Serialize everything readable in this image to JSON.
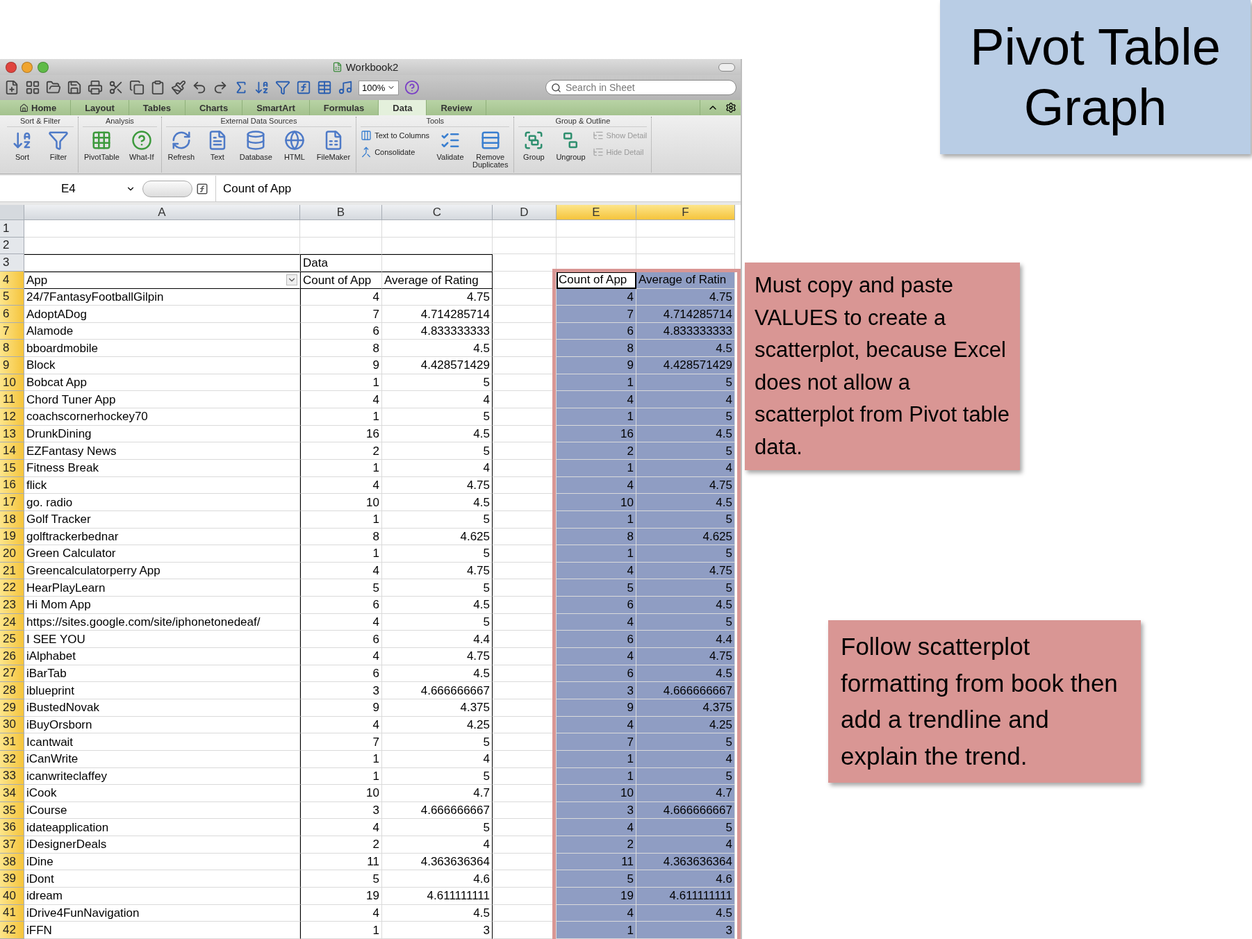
{
  "slide_title": "Pivot Table Graph",
  "callouts": [
    "Must copy and paste VALUES to create a scatterplot, because Excel does not allow a scatterplot from Pivot table data.",
    "Follow scatterplot formatting from book then add a trendline and explain the trend."
  ],
  "window": {
    "title": "Workbook2",
    "zoom": "100%",
    "search": {
      "placeholder": "Search in Sheet"
    }
  },
  "tabs": [
    {
      "label": "Home",
      "selected": false
    },
    {
      "label": "Layout",
      "selected": false
    },
    {
      "label": "Tables",
      "selected": false
    },
    {
      "label": "Charts",
      "selected": false
    },
    {
      "label": "SmartArt",
      "selected": false
    },
    {
      "label": "Formulas",
      "selected": false
    },
    {
      "label": "Data",
      "selected": true
    },
    {
      "label": "Review",
      "selected": false
    }
  ],
  "ribbon": [
    {
      "title": "Sort & Filter",
      "buttons": [
        {
          "label": "Sort",
          "kind": "large",
          "disabled": false
        },
        {
          "label": "Filter",
          "kind": "large",
          "disabled": false
        }
      ]
    },
    {
      "title": "Analysis",
      "buttons": [
        {
          "label": "PivotTable",
          "kind": "large",
          "disabled": false
        },
        {
          "label": "What-If",
          "kind": "large",
          "disabled": false
        }
      ]
    },
    {
      "title": "External Data Sources",
      "buttons": [
        {
          "label": "Refresh",
          "kind": "large",
          "disabled": false
        },
        {
          "label": "Text",
          "kind": "large",
          "disabled": false
        },
        {
          "label": "Database",
          "kind": "large",
          "disabled": false
        },
        {
          "label": "HTML",
          "kind": "large",
          "disabled": false
        },
        {
          "label": "FileMaker",
          "kind": "large",
          "disabled": false
        }
      ]
    },
    {
      "title": "Tools",
      "buttons": [
        {
          "label": "Text to Columns",
          "kind": "small",
          "disabled": false
        },
        {
          "label": "Consolidate",
          "kind": "small",
          "disabled": false
        },
        {
          "label": "Validate",
          "kind": "large",
          "disabled": false
        },
        {
          "label": "Remove Duplicates",
          "kind": "large",
          "disabled": false
        }
      ]
    },
    {
      "title": "Group & Outline",
      "buttons": [
        {
          "label": "Group",
          "kind": "large",
          "disabled": false
        },
        {
          "label": "Ungroup",
          "kind": "large",
          "disabled": false
        },
        {
          "label": "Show Detail",
          "kind": "small",
          "disabled": true
        },
        {
          "label": "Hide Detail",
          "kind": "small",
          "disabled": true
        }
      ]
    }
  ],
  "formula_bar": {
    "name_box": "E4",
    "formula": "Count of App"
  },
  "columns": [
    {
      "label": "A",
      "selected": false
    },
    {
      "label": "B",
      "selected": false
    },
    {
      "label": "C",
      "selected": false
    },
    {
      "label": "D",
      "selected": false
    },
    {
      "label": "E",
      "selected": true
    },
    {
      "label": "F",
      "selected": true
    }
  ],
  "rows": [
    {
      "number": "1",
      "kind": "blank",
      "selected": false,
      "cells": {}
    },
    {
      "number": "2",
      "kind": "blank",
      "selected": false,
      "cells": {}
    },
    {
      "number": "3",
      "kind": "caption",
      "selected": false,
      "cells": {
        "b": "Data"
      }
    },
    {
      "number": "4",
      "kind": "header",
      "selected": true,
      "cells": {
        "a": "App",
        "b": "Count of App",
        "c": "Average of Rating",
        "e": "Count of App",
        "f": "Average of Ratin"
      }
    },
    {
      "number": "5",
      "kind": "record",
      "selected": true,
      "cells": {
        "a": "24/7FantasyFootballGilpin",
        "b": "4",
        "c": "4.75",
        "e": "4",
        "f": "4.75"
      }
    },
    {
      "number": "6",
      "kind": "record",
      "selected": true,
      "cells": {
        "a": "AdoptADog",
        "b": "7",
        "c": "4.714285714",
        "e": "7",
        "f": "4.714285714"
      }
    },
    {
      "number": "7",
      "kind": "record",
      "selected": true,
      "cells": {
        "a": "Alamode",
        "b": "6",
        "c": "4.833333333",
        "e": "6",
        "f": "4.833333333"
      }
    },
    {
      "number": "8",
      "kind": "record",
      "selected": true,
      "cells": {
        "a": "bboardmobile",
        "b": "8",
        "c": "4.5",
        "e": "8",
        "f": "4.5"
      }
    },
    {
      "number": "9",
      "kind": "record",
      "selected": true,
      "cells": {
        "a": "Block",
        "b": "9",
        "c": "4.428571429",
        "e": "9",
        "f": "4.428571429"
      }
    },
    {
      "number": "10",
      "kind": "record",
      "selected": true,
      "cells": {
        "a": "Bobcat App",
        "b": "1",
        "c": "5",
        "e": "1",
        "f": "5"
      }
    },
    {
      "number": "11",
      "kind": "record",
      "selected": true,
      "cells": {
        "a": "Chord Tuner App",
        "b": "4",
        "c": "4",
        "e": "4",
        "f": "4"
      }
    },
    {
      "number": "12",
      "kind": "record",
      "selected": true,
      "cells": {
        "a": "coachscornerhockey70",
        "b": "1",
        "c": "5",
        "e": "1",
        "f": "5"
      }
    },
    {
      "number": "13",
      "kind": "record",
      "selected": true,
      "cells": {
        "a": "DrunkDining",
        "b": "16",
        "c": "4.5",
        "e": "16",
        "f": "4.5"
      }
    },
    {
      "number": "14",
      "kind": "record",
      "selected": true,
      "cells": {
        "a": "EZFantasy News",
        "b": "2",
        "c": "5",
        "e": "2",
        "f": "5"
      }
    },
    {
      "number": "15",
      "kind": "record",
      "selected": true,
      "cells": {
        "a": "Fitness Break",
        "b": "1",
        "c": "4",
        "e": "1",
        "f": "4"
      }
    },
    {
      "number": "16",
      "kind": "record",
      "selected": true,
      "cells": {
        "a": "flick",
        "b": "4",
        "c": "4.75",
        "e": "4",
        "f": "4.75"
      }
    },
    {
      "number": "17",
      "kind": "record",
      "selected": true,
      "cells": {
        "a": "go. radio",
        "b": "10",
        "c": "4.5",
        "e": "10",
        "f": "4.5"
      }
    },
    {
      "number": "18",
      "kind": "record",
      "selected": true,
      "cells": {
        "a": "Golf Tracker",
        "b": "1",
        "c": "5",
        "e": "1",
        "f": "5"
      }
    },
    {
      "number": "19",
      "kind": "record",
      "selected": true,
      "cells": {
        "a": "golftrackerbednar",
        "b": "8",
        "c": "4.625",
        "e": "8",
        "f": "4.625"
      }
    },
    {
      "number": "20",
      "kind": "record",
      "selected": true,
      "cells": {
        "a": "Green Calculator",
        "b": "1",
        "c": "5",
        "e": "1",
        "f": "5"
      }
    },
    {
      "number": "21",
      "kind": "record",
      "selected": true,
      "cells": {
        "a": "Greencalculatorperry App",
        "b": "4",
        "c": "4.75",
        "e": "4",
        "f": "4.75"
      }
    },
    {
      "number": "22",
      "kind": "record",
      "selected": true,
      "cells": {
        "a": "HearPlayLearn",
        "b": "5",
        "c": "5",
        "e": "5",
        "f": "5"
      }
    },
    {
      "number": "23",
      "kind": "record",
      "selected": true,
      "cells": {
        "a": "Hi Mom App",
        "b": "6",
        "c": "4.5",
        "e": "6",
        "f": "4.5"
      }
    },
    {
      "number": "24",
      "kind": "record",
      "selected": true,
      "cells": {
        "a": "https://sites.google.com/site/iphonetonedeaf/",
        "b": "4",
        "c": "5",
        "e": "4",
        "f": "5"
      }
    },
    {
      "number": "25",
      "kind": "record",
      "selected": true,
      "cells": {
        "a": "I SEE YOU",
        "b": "6",
        "c": "4.4",
        "e": "6",
        "f": "4.4"
      }
    },
    {
      "number": "26",
      "kind": "record",
      "selected": true,
      "cells": {
        "a": "iAlphabet",
        "b": "4",
        "c": "4.75",
        "e": "4",
        "f": "4.75"
      }
    },
    {
      "number": "27",
      "kind": "record",
      "selected": true,
      "cells": {
        "a": "iBarTab",
        "b": "6",
        "c": "4.5",
        "e": "6",
        "f": "4.5"
      }
    },
    {
      "number": "28",
      "kind": "record",
      "selected": true,
      "cells": {
        "a": "iblueprint",
        "b": "3",
        "c": "4.666666667",
        "e": "3",
        "f": "4.666666667"
      }
    },
    {
      "number": "29",
      "kind": "record",
      "selected": true,
      "cells": {
        "a": "iBustedNovak",
        "b": "9",
        "c": "4.375",
        "e": "9",
        "f": "4.375"
      }
    },
    {
      "number": "30",
      "kind": "record",
      "selected": true,
      "cells": {
        "a": "iBuyOrsborn",
        "b": "4",
        "c": "4.25",
        "e": "4",
        "f": "4.25"
      }
    },
    {
      "number": "31",
      "kind": "record",
      "selected": true,
      "cells": {
        "a": "Icantwait",
        "b": "7",
        "c": "5",
        "e": "7",
        "f": "5"
      }
    },
    {
      "number": "32",
      "kind": "record",
      "selected": true,
      "cells": {
        "a": "iCanWrite",
        "b": "1",
        "c": "4",
        "e": "1",
        "f": "4"
      }
    },
    {
      "number": "33",
      "kind": "record",
      "selected": true,
      "cells": {
        "a": "icanwriteclaffey",
        "b": "1",
        "c": "5",
        "e": "1",
        "f": "5"
      }
    },
    {
      "number": "34",
      "kind": "record",
      "selected": true,
      "cells": {
        "a": "iCook",
        "b": "10",
        "c": "4.7",
        "e": "10",
        "f": "4.7"
      }
    },
    {
      "number": "35",
      "kind": "record",
      "selected": true,
      "cells": {
        "a": "iCourse",
        "b": "3",
        "c": "4.666666667",
        "e": "3",
        "f": "4.666666667"
      }
    },
    {
      "number": "36",
      "kind": "record",
      "selected": true,
      "cells": {
        "a": "idateapplication",
        "b": "4",
        "c": "5",
        "e": "4",
        "f": "5"
      }
    },
    {
      "number": "37",
      "kind": "record",
      "selected": true,
      "cells": {
        "a": "iDesignerDeals",
        "b": "2",
        "c": "4",
        "e": "2",
        "f": "4"
      }
    },
    {
      "number": "38",
      "kind": "record",
      "selected": true,
      "cells": {
        "a": "iDine",
        "b": "11",
        "c": "4.363636364",
        "e": "11",
        "f": "4.363636364"
      }
    },
    {
      "number": "39",
      "kind": "record",
      "selected": true,
      "cells": {
        "a": "iDont",
        "b": "5",
        "c": "4.6",
        "e": "5",
        "f": "4.6"
      }
    },
    {
      "number": "40",
      "kind": "record",
      "selected": true,
      "cells": {
        "a": "idream",
        "b": "19",
        "c": "4.611111111",
        "e": "19",
        "f": "4.611111111"
      }
    },
    {
      "number": "41",
      "kind": "record",
      "selected": true,
      "cells": {
        "a": "iDrive4FunNavigation",
        "b": "4",
        "c": "4.5",
        "e": "4",
        "f": "4.5"
      }
    },
    {
      "number": "42",
      "kind": "record",
      "selected": true,
      "cells": {
        "a": "iFFN",
        "b": "1",
        "c": "3",
        "e": "1",
        "f": "3"
      }
    }
  ]
}
